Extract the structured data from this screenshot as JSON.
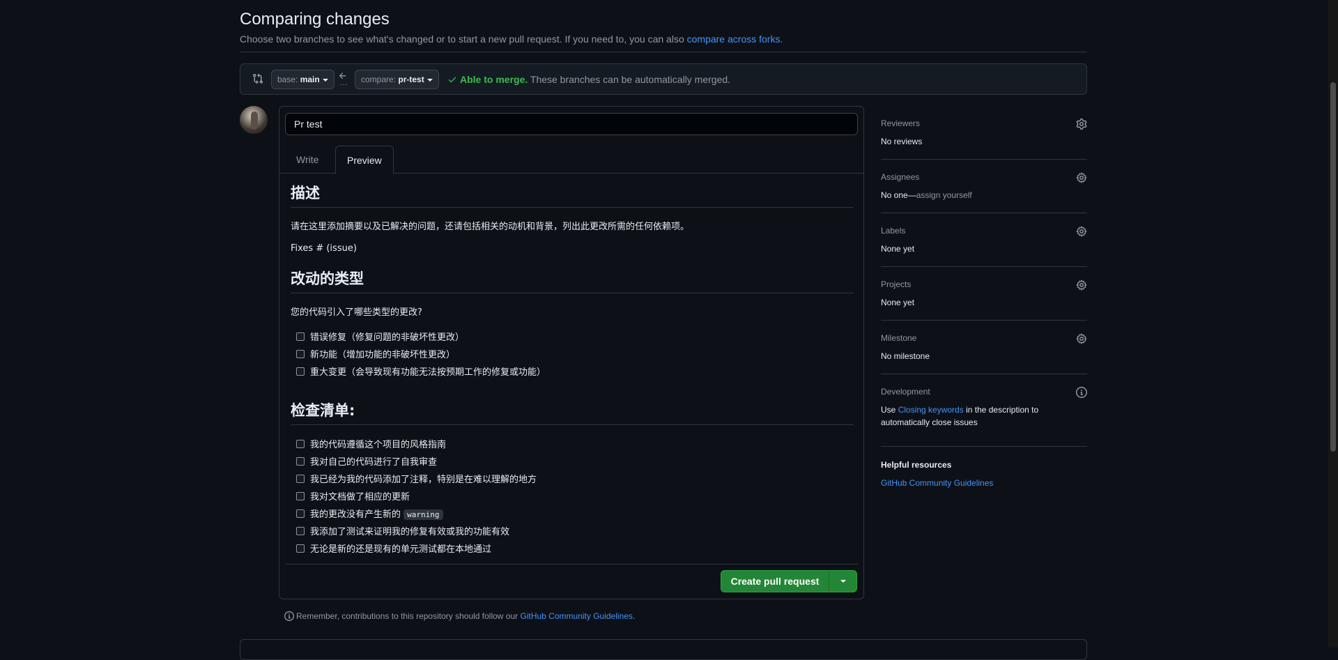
{
  "header": {
    "title": "Comparing changes",
    "subtitle_prefix": "Choose two branches to see what's changed or to start a new pull request. If you need to, you can also ",
    "subtitle_link": "compare across forks."
  },
  "compare": {
    "base_prefix": "base: ",
    "base_branch": "main",
    "compare_prefix": "compare: ",
    "compare_branch": "pr-test",
    "dots": "...",
    "merge_ok": "Able to merge.",
    "merge_detail": " These branches can be automatically merged."
  },
  "editor": {
    "title_value": "Pr test",
    "tabs": [
      "Write",
      "Preview"
    ],
    "active_tab": "Preview"
  },
  "preview": {
    "h_desc": "描述",
    "p_desc": "请在这里添加摘要以及已解决的问题，还请包括相关的动机和背景，列出此更改所需的任何依赖项。",
    "p_fixes": "Fixes # (issue)",
    "h_types": "改动的类型",
    "p_types": "您的代码引入了哪些类型的更改?",
    "type_items": [
      "错误修复（修复问题的非破坏性更改）",
      "新功能（增加功能的非破坏性更改）",
      "重大变更（会导致现有功能无法按预期工作的修复或功能）"
    ],
    "h_checklist": "检查清单:",
    "checklist_items": [
      "我的代码遵循这个项目的风格指南",
      "我对自己的代码进行了自我审查",
      "我已经为我的代码添加了注释，特别是在难以理解的地方",
      "我对文档做了相应的更新"
    ],
    "warning_prefix": "我的更改没有产生新的 ",
    "warning_code": "warning",
    "checklist_items_after": [
      "我添加了测试来证明我的修复有效或我的功能有效",
      "无论是新的还是现有的单元测试都在本地通过"
    ]
  },
  "actions": {
    "create_label": "Create pull request"
  },
  "remember": {
    "prefix": "Remember, contributions to this repository should follow our ",
    "link": "GitHub Community Guidelines."
  },
  "sidebar": {
    "reviewers": {
      "label": "Reviewers",
      "value": "No reviews"
    },
    "assignees": {
      "label": "Assignees",
      "value": "No one—",
      "link": "assign yourself"
    },
    "labels": {
      "label": "Labels",
      "value": "None yet"
    },
    "projects": {
      "label": "Projects",
      "value": "None yet"
    },
    "milestone": {
      "label": "Milestone",
      "value": "No milestone"
    },
    "development": {
      "label": "Development",
      "text_before": "Use ",
      "link": "Closing keywords",
      "text_after": " in the description to automatically close issues"
    },
    "helpful": {
      "label": "Helpful resources",
      "link": "GitHub Community Guidelines"
    }
  },
  "colors": {
    "background": "#0d1117",
    "accent_link": "#4493f8",
    "success": "#3fb950",
    "primary_button": "#238636"
  }
}
